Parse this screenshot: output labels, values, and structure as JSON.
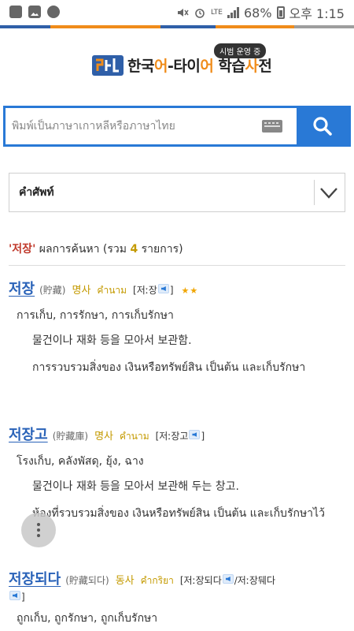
{
  "status_bar": {
    "network": "LTE",
    "battery": "68%",
    "time": "오후 1:15"
  },
  "colors": {
    "stripe": [
      "#2f5fa8",
      "#f08c1a",
      "#2f5fa8",
      "#f08c1a",
      "#9e9e9e"
    ],
    "search_border": "#2979d6",
    "headword": "#2962b8",
    "pos": "#c49a00"
  },
  "header": {
    "logo_text_a": "한국",
    "logo_text_b": "어",
    "logo_text_c": "-타이",
    "logo_text_d": "어",
    "logo_text_e": " 학습",
    "logo_text_f": "사",
    "logo_text_g": "전",
    "badge": "시범 운영 중"
  },
  "search": {
    "placeholder": "พิมพ์เป็นภาษาเกาหลีหรือภาษาไทย",
    "value": ""
  },
  "filter": {
    "selected": "คำศัพท์"
  },
  "summary": {
    "q_open": "'",
    "keyword": "저장",
    "q_close": "'",
    "prefix": " ผลการค้นหา (รวม ",
    "count": "4",
    "suffix": " รายการ)"
  },
  "entries": [
    {
      "word": "저장",
      "hanja": "(貯藏)",
      "pos_ko": "명사",
      "pos_th": "คำนาม",
      "pron": "[저ː장",
      "pron_end": "]",
      "stars": "★★",
      "translation": "การเก็บ, การรักษา, การเก็บรักษา",
      "def_ko": "물건이나 재화 등을 모아서 보관함.",
      "def_th": "การรวบรวมสิ่งของ เงินหรือทรัพย์สิน เป็นต้น และเก็บรักษา"
    },
    {
      "word": "저장고",
      "hanja": "(貯藏庫)",
      "pos_ko": "명사",
      "pos_th": "คำนาม",
      "pron": "[저ː장고",
      "pron_end": "]",
      "translation": "โรงเก็บ, คลังพัสดุ, ยุ้ง, ฉาง",
      "def_ko": "물건이나 재화 등을 모아서 보관해 두는 창고.",
      "def_th": "ห้องที่รวบรวมสิ่งของ เงินหรือทรัพย์สิน เป็นต้น และเก็บรักษาไว้"
    },
    {
      "word": "저장되다",
      "hanja": "(貯藏되다)",
      "pos_ko": "동사",
      "pos_th": "คำกริยา",
      "pron": "[저ː장되다",
      "pron_mid": "/저ː장뒈다",
      "pron_end": "]",
      "translation": "ถูกเก็บ, ถูกรักษา, ถูกเก็บรักษา"
    }
  ]
}
